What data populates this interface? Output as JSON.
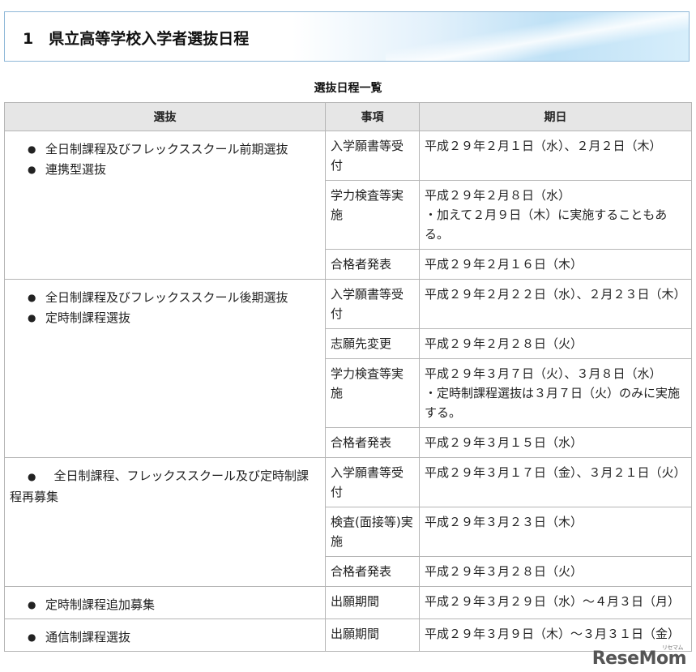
{
  "heading": {
    "text": "1　県立高等学校入学者選抜日程"
  },
  "caption": "選抜日程一覧",
  "table": {
    "headers": [
      "選抜",
      "事項",
      "期日"
    ],
    "groups": [
      {
        "selection": [
          "全日制課程及びフレックススクール前期選抜",
          "連携型選抜"
        ],
        "rows": [
          {
            "item": "入学願書等受付",
            "date": [
              "平成２９年２月１日（水）、２月２日（木）"
            ]
          },
          {
            "item": "学力検査等実施",
            "date": [
              "平成２９年２月８日（水）",
              "・加えて２月９日（木）に実施することもある。"
            ]
          },
          {
            "item": "合格者発表",
            "date": [
              "平成２９年２月１６日（木）"
            ]
          }
        ]
      },
      {
        "selection": [
          "全日制課程及びフレックススクール後期選抜",
          "定時制課程選抜"
        ],
        "rows": [
          {
            "item": "入学願書等受付",
            "date": [
              "平成２９年２月２２日（水）、２月２３日（木）"
            ]
          },
          {
            "item": "志願先変更",
            "date": [
              "平成２９年２月２８日（火）"
            ]
          },
          {
            "item": "学力検査等実施",
            "date": [
              "平成２９年３月７日（火）、３月８日（水）",
              "・定時制課程選抜は３月７日（火）のみに実施する。"
            ]
          },
          {
            "item": "合格者発表",
            "date": [
              "平成２９年３月１５日（水）"
            ]
          }
        ]
      },
      {
        "selection": [
          "全日制課程、フレックススクール及び定時制課程再募集"
        ],
        "inline": true,
        "rows": [
          {
            "item": "入学願書等受付",
            "date": [
              "平成２９年３月１７日（金）、３月２１日（火）"
            ]
          },
          {
            "item": "検査(面接等)実施",
            "date": [
              "平成２９年３月２３日（木）"
            ]
          },
          {
            "item": "合格者発表",
            "date": [
              "平成２９年３月２８日（火）"
            ]
          }
        ]
      },
      {
        "selection": [
          "定時制課程追加募集"
        ],
        "rows": [
          {
            "item": "出願期間",
            "date": [
              "平成２９年３月２９日（水）～４月３日（月）"
            ]
          }
        ]
      },
      {
        "selection": [
          "通信制課程選抜"
        ],
        "rows": [
          {
            "item": "出願期間",
            "date": [
              "平成２９年３月９日（木）～３月３１日（金）"
            ]
          }
        ]
      }
    ]
  },
  "watermark": {
    "text": "ReseMom",
    "sub": "リセマム"
  }
}
